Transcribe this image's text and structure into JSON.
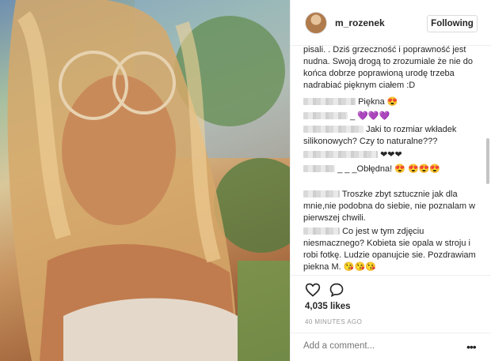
{
  "post": {
    "username": "m_rozenek",
    "follow_label": "Following",
    "likes": "4,035 likes",
    "time_ago": "40 MINUTES AGO",
    "add_comment_placeholder": "Add a comment...",
    "more_icon": "more-horizontal-icon"
  },
  "comments": [
    {
      "text": "pisali. . Dziś grzeczność i poprawność jest nudna. Swoją drogą to zrozumiale że nie do końca dobrze poprawioną urodę trzeba nadrabiać pięknym ciałem :D"
    },
    {
      "text": "Piękna 😍"
    },
    {
      "text": "_ 💜💜💜"
    },
    {
      "text": "Jaki to rozmiar wkładek silikonowych? Czy to naturalne???"
    },
    {
      "text": "❤❤❤"
    },
    {
      "text": "_ _ _Obłędna! 😍 😍😍😍"
    },
    {
      "text": "Troszke zbyt sztucznie jak dla mnie,nie podobna do siebie, nie poznalam w pierwszej chwili."
    },
    {
      "text": "Co jest w tym zdjęciu niesmacznego? Kobieta sie opala w stroju i robi fotkę. Ludzie opanujcie sie. Pozdrawiam piekna M. 😘😘😘"
    }
  ]
}
